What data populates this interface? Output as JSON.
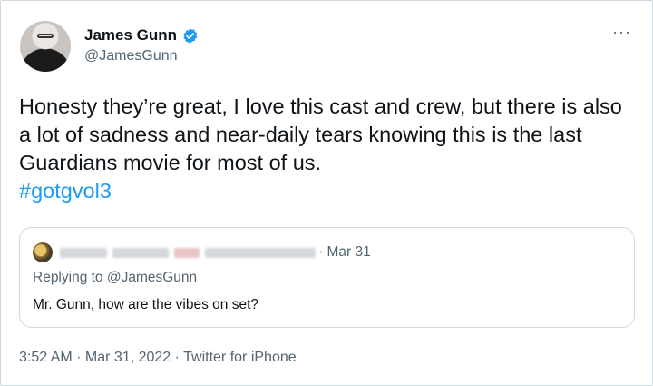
{
  "author": {
    "display_name": "James Gunn",
    "handle": "@JamesGunn",
    "verified": true
  },
  "more_icon": "···",
  "tweet": {
    "text": "Honesty they’re great, I love this cast and crew, but there is also a lot of sadness and near-daily tears knowing this is the last Guardians movie for most of us.",
    "hashtag": "#gotgvol3"
  },
  "quoted_tweet": {
    "date": "· Mar 31",
    "replying_prefix": "Replying to ",
    "replying_to": "@JamesGunn",
    "text": "Mr. Gunn, how are the vibes on set?"
  },
  "meta": {
    "time": "3:52 AM",
    "sep1": " · ",
    "date": "Mar 31, 2022",
    "sep2": " · ",
    "source": "Twitter for iPhone"
  },
  "colors": {
    "accent": "#1d9bf0",
    "text": "#0f1419",
    "secondary": "#536471",
    "border": "#cfd9de"
  }
}
